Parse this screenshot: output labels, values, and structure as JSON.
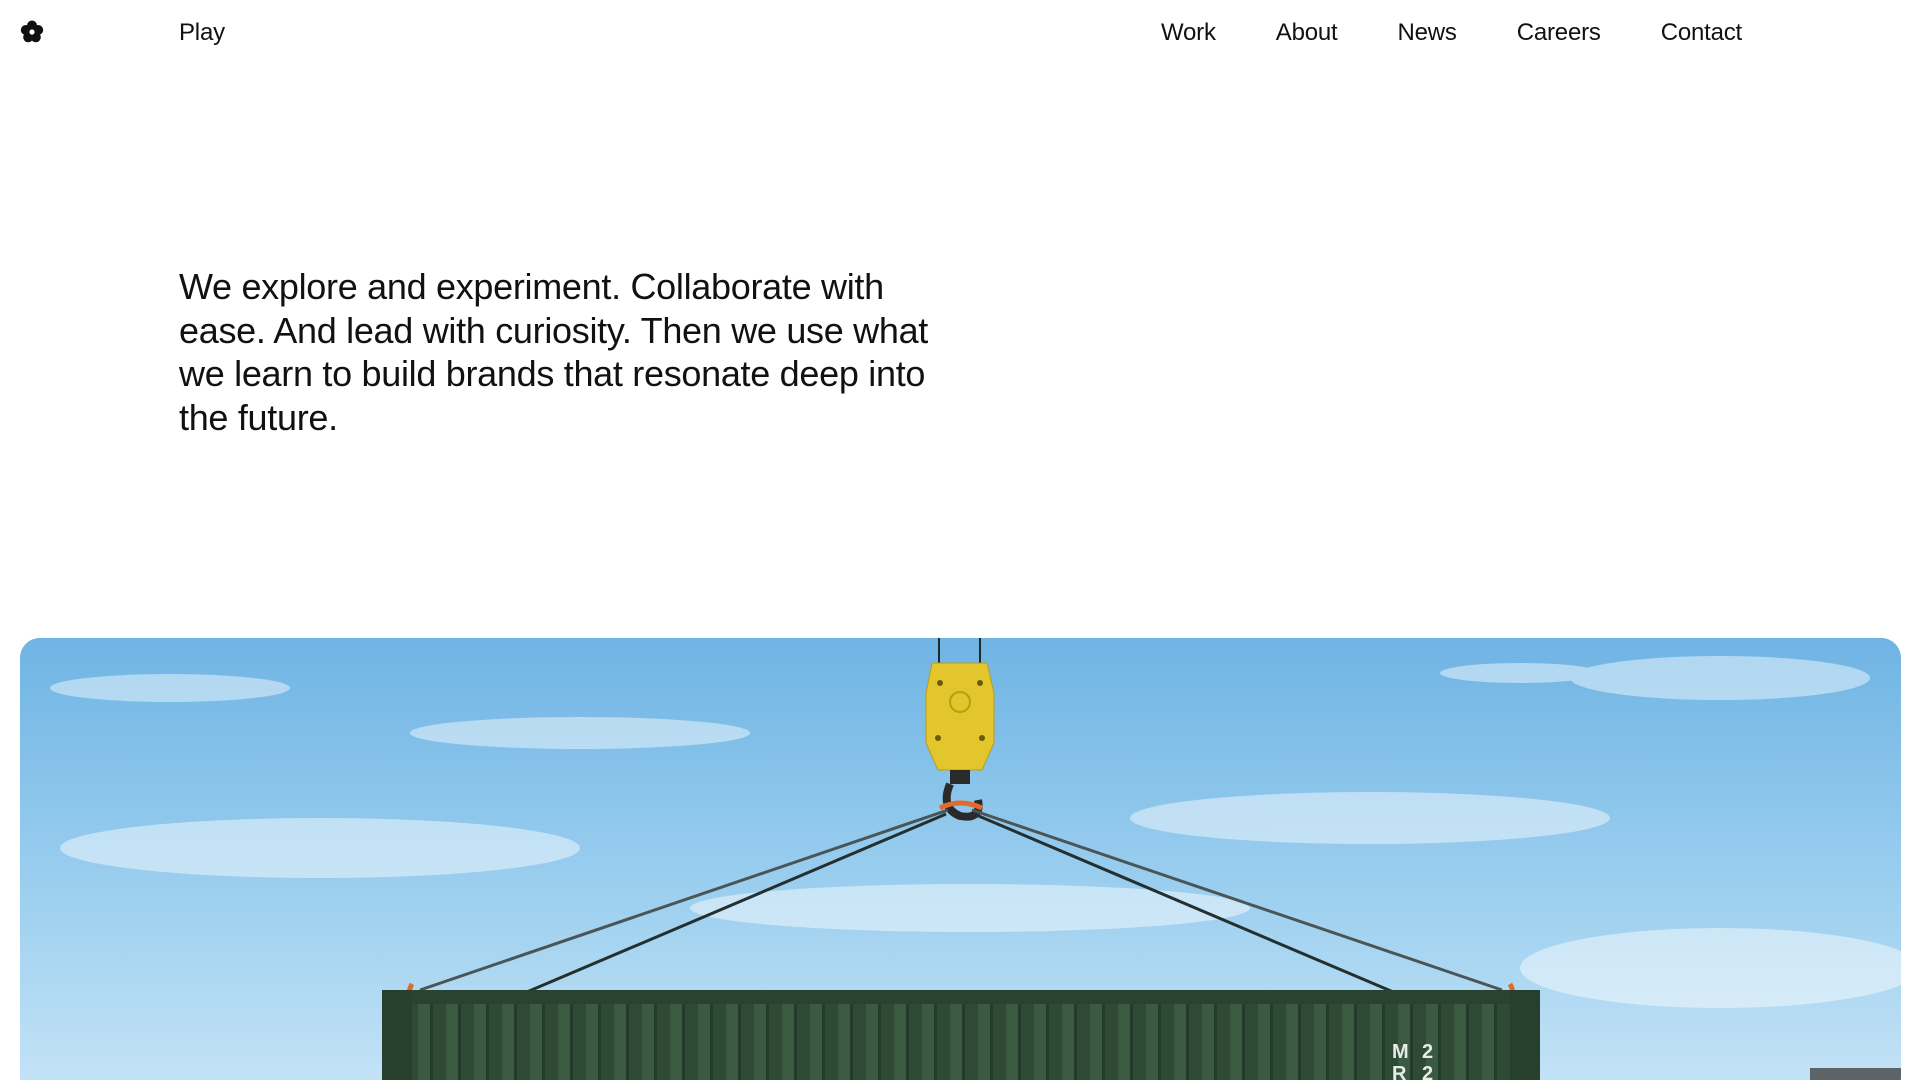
{
  "header": {
    "logo_icon": "flower-logo-icon",
    "play_label": "Play",
    "nav": [
      {
        "label": "Work"
      },
      {
        "label": "About"
      },
      {
        "label": "News"
      },
      {
        "label": "Careers"
      },
      {
        "label": "Contact"
      }
    ]
  },
  "intro": {
    "text": "We explore and experiment. Collaborate with ease. And lead with curiosity. Then we use what we learn to build brands that resonate deep into the future."
  },
  "hero": {
    "subject": "crane-hook-lifting-shipping-container-image",
    "container_marking": [
      "M",
      "R",
      "2",
      "2"
    ],
    "colors": {
      "sky": "#8cc6ec",
      "hook": "#e3c62b",
      "container": "#2e4a35",
      "sling": "#e06a2a"
    }
  }
}
